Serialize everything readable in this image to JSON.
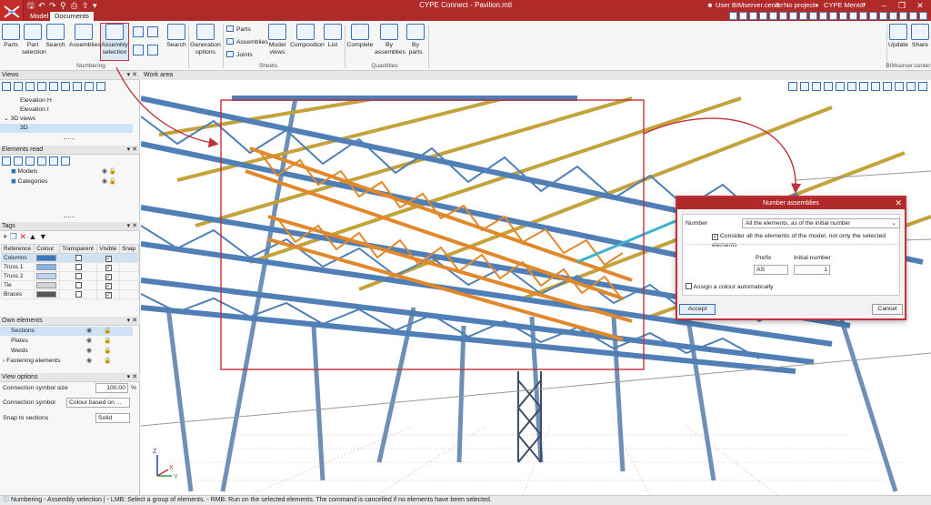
{
  "app": {
    "title": "CYPE Connect - Pavilion.mtl",
    "user": "User BIMserver.center",
    "project": "No project",
    "mentor": "CYPE Mentor"
  },
  "tabs": [
    "Model",
    "Documents"
  ],
  "ribbon": {
    "parts": "Parts",
    "part_selection": "Part\nselection",
    "search": "Search",
    "assemblies": "Assemblies",
    "assembly_selection": "Assembly\nselection",
    "search2": "Search",
    "numbering_group": "Numbering",
    "generation_options": "Generation\noptions",
    "sheets_parts": "Parts",
    "sheets_assemblies": "Assemblies",
    "sheets_joints": "Joints",
    "model_views": "Model\nviews",
    "composition": "Composition",
    "list": "List",
    "sheets_group": "Sheets",
    "complete": "Complete",
    "by_assemblies": "By\nassemblies",
    "by_parts": "By\nparts",
    "quantities_group": "Quantities",
    "update": "Update",
    "share": "Share",
    "bim_group": "BIMserver.center"
  },
  "views_panel": {
    "title": "Views",
    "items": [
      "Elevation H",
      "Elevation I",
      "3D views",
      "3D"
    ]
  },
  "elements_panel": {
    "title": "Elements read",
    "items": [
      "Models",
      "Categories"
    ]
  },
  "tags_panel": {
    "title": "Tags",
    "columns": [
      "Reference",
      "Colour",
      "Transparent",
      "Visible",
      "Snap"
    ],
    "rows": [
      {
        "ref": "Columns",
        "color": "#3a78c6",
        "transparent": false,
        "visible": true
      },
      {
        "ref": "Truss 1",
        "color": "#7fb3ea",
        "transparent": false,
        "visible": true
      },
      {
        "ref": "Truss 2",
        "color": "#b9d6f2",
        "transparent": false,
        "visible": true
      },
      {
        "ref": "Tie",
        "color": "#d4d4d4",
        "transparent": false,
        "visible": true
      },
      {
        "ref": "Braces",
        "color": "#555555",
        "transparent": false,
        "visible": true
      }
    ]
  },
  "own_elements": {
    "title": "Own elements",
    "items": [
      "Sections",
      "Plates",
      "Welds",
      "Fastening elements"
    ]
  },
  "view_options": {
    "title": "View options",
    "symbol_size_label": "Connection symbol size",
    "symbol_size_value": "100.00",
    "symbol_size_unit": "%",
    "symbol_label": "Connection symbol",
    "symbol_value": "Colour based on ...",
    "snap_label": "Snap to sections",
    "snap_value": "Solid"
  },
  "work_area": {
    "title": "Work area"
  },
  "dialog": {
    "title": "Number assemblies",
    "number_label": "Number",
    "number_value": "All the elements, as of the initial number",
    "consider_label": "Consider all the elements of the model, not only the selected elements",
    "consider_checked": true,
    "prefix_label": "Prefix",
    "initial_label": "Initial number",
    "prefix_value": "AS",
    "initial_value": "1",
    "colour_label": "Assign a colour automatically",
    "colour_checked": false,
    "accept": "Accept",
    "cancel": "Cancel"
  },
  "status": "Numbering - Assembly selection  |  - LMB: Select a group of elements. - RMB: Run on the selected elements. The command is cancelled if no elements have been selected.",
  "colors": {
    "accent": "#b12a2a",
    "highlight": "#d0323c",
    "steel": "#4f7fb6",
    "truss_selected": "#e0882b",
    "purlin": "#c4a23c"
  }
}
